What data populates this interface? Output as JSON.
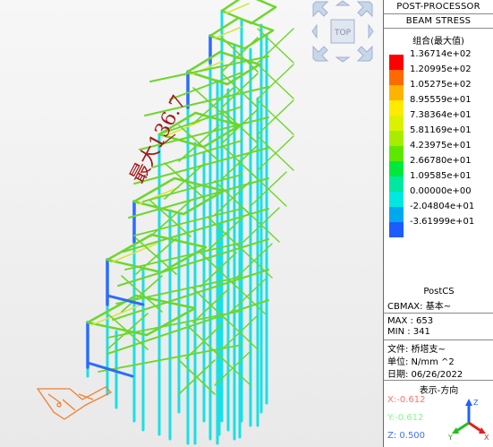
{
  "panel": {
    "header1": "POST-PROCESSOR",
    "header2": "BEAM STRESS",
    "legend_title": "组合(最大值)",
    "legend": [
      {
        "value": "1.36714e+02",
        "color": "#ff0000"
      },
      {
        "value": "1.20995e+02",
        "color": "#ff6a00"
      },
      {
        "value": "1.05275e+02",
        "color": "#ffb300"
      },
      {
        "value": "8.95559e+01",
        "color": "#ffea00"
      },
      {
        "value": "7.38364e+01",
        "color": "#dcf000"
      },
      {
        "value": "5.81169e+01",
        "color": "#a8ec00"
      },
      {
        "value": "4.23975e+01",
        "color": "#5ee800"
      },
      {
        "value": "2.66780e+01",
        "color": "#00e83c"
      },
      {
        "value": "1.09585e+01",
        "color": "#00e8a0"
      },
      {
        "value": "0.00000e+00",
        "color": "#00e8e0"
      },
      {
        "value": "-2.04804e+01",
        "color": "#00a8f0"
      },
      {
        "value": "-3.61999e+01",
        "color": "#1a5cff"
      }
    ],
    "postcs": "PostCS",
    "cbmax": "CBMAX: 基本~",
    "max": "MAX : 653",
    "min": "MIN : 341",
    "file": "文件: 桥塔支~",
    "unit": "单位: N/mm ^2",
    "date": "日期: 06/26/2022",
    "view_dir_title": "表示-方向",
    "x": "X:-0.612",
    "y": "Y:-0.612",
    "z": "Z: 0.500",
    "colors": {
      "x": "#ff7070",
      "y": "#80ff80",
      "z": "#4070ff"
    }
  },
  "viewport": {
    "annotation": "最大136.7",
    "annotation_color": "#a01818",
    "viewcube_label": "TOP"
  },
  "axis_triad": {
    "x": "X",
    "y": "Y",
    "z": "Z"
  }
}
